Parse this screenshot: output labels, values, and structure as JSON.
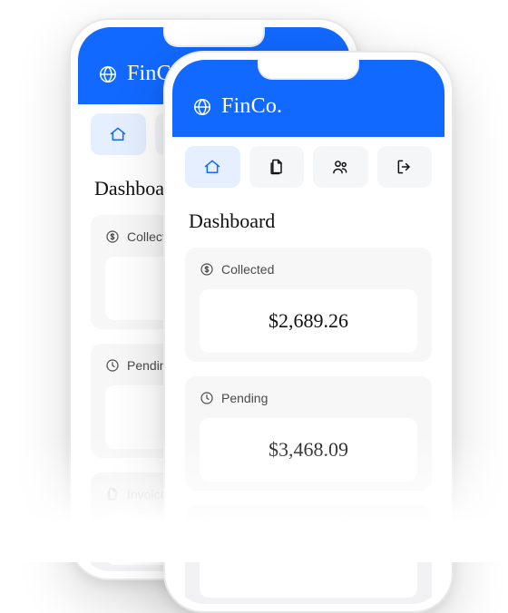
{
  "brand": {
    "name": "FinCo."
  },
  "nav": {
    "items": [
      "home",
      "documents",
      "users",
      "exit"
    ],
    "activeIndex": 0
  },
  "page": {
    "title": "Dashboard"
  },
  "cards": {
    "collected": {
      "label": "Collected",
      "value": "$2,689.26"
    },
    "pending": {
      "label": "Pending",
      "value": "$3,468.09"
    },
    "invoices": {
      "label": "Invoices"
    }
  }
}
